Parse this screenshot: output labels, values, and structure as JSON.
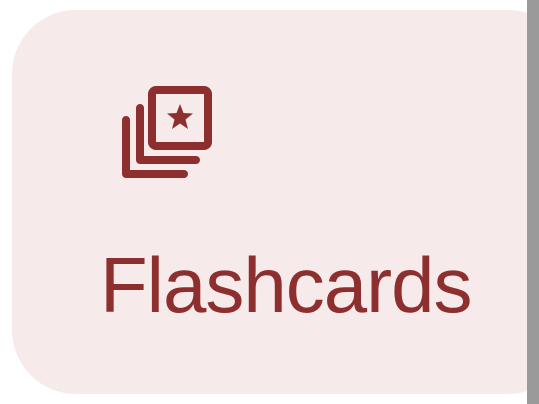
{
  "card": {
    "label": "Flashcards",
    "icon": "flashcards-icon",
    "accent_color": "#8e2f2f",
    "background_color": "#f6eaea"
  }
}
